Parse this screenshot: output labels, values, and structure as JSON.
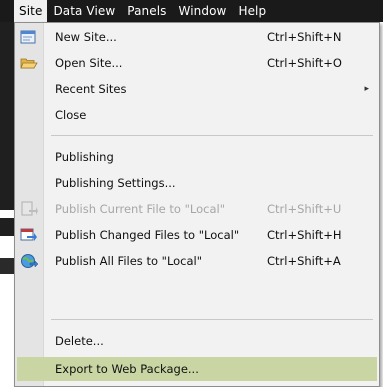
{
  "menubar": {
    "items": [
      {
        "label": "Site"
      },
      {
        "label": "Data View"
      },
      {
        "label": "Panels"
      },
      {
        "label": "Window"
      },
      {
        "label": "Help"
      }
    ]
  },
  "menu": {
    "new_site": {
      "label": "New Site...",
      "shortcut": "Ctrl+Shift+N"
    },
    "open_site": {
      "label": "Open Site...",
      "shortcut": "Ctrl+Shift+O"
    },
    "recent_sites": {
      "label": "Recent Sites"
    },
    "close": {
      "label": "Close"
    },
    "publishing": {
      "label": "Publishing"
    },
    "publishing_settings": {
      "label": "Publishing Settings..."
    },
    "publish_current": {
      "label": "Publish Current File to \"Local\"",
      "shortcut": "Ctrl+Shift+U"
    },
    "publish_changed": {
      "label": "Publish Changed Files to \"Local\"",
      "shortcut": "Ctrl+Shift+H"
    },
    "publish_all": {
      "label": "Publish All Files to \"Local\"",
      "shortcut": "Ctrl+Shift+A"
    },
    "delete": {
      "label": "Delete..."
    },
    "export": {
      "label": "Export to Web Package..."
    }
  },
  "colors": {
    "menubar_bg": "#1a1a1a",
    "menu_bg": "#f2f2f2",
    "highlight": "#c9d6a4",
    "disabled_text": "#a6a6a6"
  }
}
